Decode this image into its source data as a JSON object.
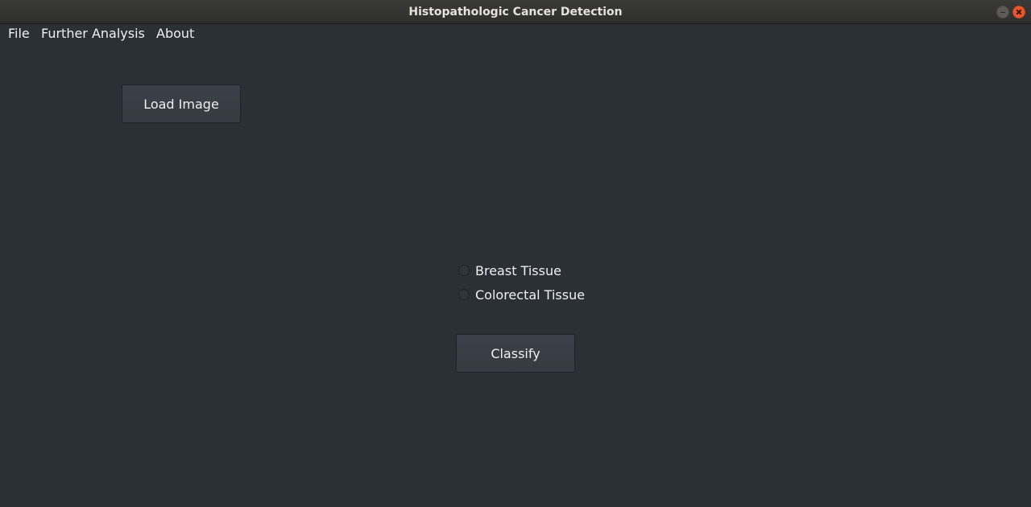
{
  "window": {
    "title": "Histopathologic Cancer Detection"
  },
  "menubar": {
    "items": [
      {
        "label": "File"
      },
      {
        "label": "Further Analysis"
      },
      {
        "label": "About"
      }
    ]
  },
  "main": {
    "load_button_label": "Load Image",
    "tissue_options": [
      {
        "label": "Breast Tissue",
        "selected": false
      },
      {
        "label": "Colorectal Tissue",
        "selected": false
      }
    ],
    "classify_button_label": "Classify"
  },
  "colors": {
    "background": "#2b2f36",
    "text": "#eef0f2",
    "close_button": "#e8582d"
  },
  "icons": [
    "minimize-icon",
    "close-icon",
    "radio-unchecked-icon"
  ]
}
